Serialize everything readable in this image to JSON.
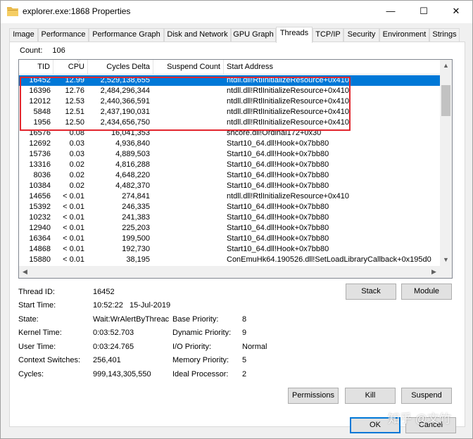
{
  "window": {
    "title": "explorer.exe:1868 Properties",
    "minimize_glyph": "—",
    "maximize_glyph": "☐",
    "close_glyph": "✕"
  },
  "tabs": [
    {
      "label": "Image"
    },
    {
      "label": "Performance"
    },
    {
      "label": "Performance Graph"
    },
    {
      "label": "Disk and Network"
    },
    {
      "label": "GPU Graph"
    },
    {
      "label": "Threads",
      "active": true
    },
    {
      "label": "TCP/IP"
    },
    {
      "label": "Security"
    },
    {
      "label": "Environment"
    },
    {
      "label": "Strings"
    }
  ],
  "count": {
    "label": "Count:",
    "value": "106"
  },
  "table": {
    "columns": [
      "TID",
      "CPU",
      "Cycles Delta",
      "Suspend Count",
      "Start Address"
    ],
    "rows": [
      {
        "tid": "16452",
        "cpu": "12.99",
        "cycles": "2,529,138,655",
        "suspend": "",
        "addr": "ntdll.dll!RtlInitializeResource+0x410",
        "selected": true
      },
      {
        "tid": "16396",
        "cpu": "12.76",
        "cycles": "2,484,296,344",
        "suspend": "",
        "addr": "ntdll.dll!RtlInitializeResource+0x410"
      },
      {
        "tid": "12012",
        "cpu": "12.53",
        "cycles": "2,440,366,591",
        "suspend": "",
        "addr": "ntdll.dll!RtlInitializeResource+0x410"
      },
      {
        "tid": "5848",
        "cpu": "12.51",
        "cycles": "2,437,190,031",
        "suspend": "",
        "addr": "ntdll.dll!RtlInitializeResource+0x410"
      },
      {
        "tid": "1956",
        "cpu": "12.50",
        "cycles": "2,434,656,750",
        "suspend": "",
        "addr": "ntdll.dll!RtlInitializeResource+0x410"
      },
      {
        "tid": "16576",
        "cpu": "0.08",
        "cycles": "16,041,353",
        "suspend": "",
        "addr": "shcore.dll!Ordinal172+0x30"
      },
      {
        "tid": "12692",
        "cpu": "0.03",
        "cycles": "4,936,840",
        "suspend": "",
        "addr": "Start10_64.dll!Hook+0x7bb80"
      },
      {
        "tid": "15736",
        "cpu": "0.03",
        "cycles": "4,889,503",
        "suspend": "",
        "addr": "Start10_64.dll!Hook+0x7bb80"
      },
      {
        "tid": "13316",
        "cpu": "0.02",
        "cycles": "4,816,288",
        "suspend": "",
        "addr": "Start10_64.dll!Hook+0x7bb80"
      },
      {
        "tid": "8036",
        "cpu": "0.02",
        "cycles": "4,648,220",
        "suspend": "",
        "addr": "Start10_64.dll!Hook+0x7bb80"
      },
      {
        "tid": "10384",
        "cpu": "0.02",
        "cycles": "4,482,370",
        "suspend": "",
        "addr": "Start10_64.dll!Hook+0x7bb80"
      },
      {
        "tid": "14656",
        "cpu": "< 0.01",
        "cycles": "274,841",
        "suspend": "",
        "addr": "ntdll.dll!RtlInitializeResource+0x410"
      },
      {
        "tid": "15392",
        "cpu": "< 0.01",
        "cycles": "246,335",
        "suspend": "",
        "addr": "Start10_64.dll!Hook+0x7bb80"
      },
      {
        "tid": "10232",
        "cpu": "< 0.01",
        "cycles": "241,383",
        "suspend": "",
        "addr": "Start10_64.dll!Hook+0x7bb80"
      },
      {
        "tid": "12940",
        "cpu": "< 0.01",
        "cycles": "225,203",
        "suspend": "",
        "addr": "Start10_64.dll!Hook+0x7bb80"
      },
      {
        "tid": "16364",
        "cpu": "< 0.01",
        "cycles": "199,500",
        "suspend": "",
        "addr": "Start10_64.dll!Hook+0x7bb80"
      },
      {
        "tid": "14868",
        "cpu": "< 0.01",
        "cycles": "192,730",
        "suspend": "",
        "addr": "Start10_64.dll!Hook+0x7bb80"
      },
      {
        "tid": "15880",
        "cpu": "< 0.01",
        "cycles": "38,195",
        "suspend": "",
        "addr": "ConEmuHk64.190526.dll!SetLoadLibraryCallback+0x195d0"
      }
    ]
  },
  "details": {
    "thread_id": {
      "label": "Thread ID:",
      "value": "16452"
    },
    "start_time": {
      "label": "Start Time:",
      "value": "10:52:22   15-Jul-2019"
    },
    "state": {
      "label": "State:",
      "value": "Wait:WrAlertByThreac"
    },
    "kernel_time": {
      "label": "Kernel Time:",
      "value": "0:03:52.703"
    },
    "user_time": {
      "label": "User Time:",
      "value": "0:03:24.765"
    },
    "context_switches": {
      "label": "Context Switches:",
      "value": "256,401"
    },
    "cycles": {
      "label": "Cycles:",
      "value": "999,143,305,550"
    },
    "base_priority": {
      "label": "Base Priority:",
      "value": "8"
    },
    "dynamic_priority": {
      "label": "Dynamic Priority:",
      "value": "9"
    },
    "io_priority": {
      "label": "I/O Priority:",
      "value": "Normal"
    },
    "memory_priority": {
      "label": "Memory Priority:",
      "value": "5"
    },
    "ideal_processor": {
      "label": "Ideal Processor:",
      "value": "2"
    }
  },
  "buttons": {
    "stack": "Stack",
    "module": "Module",
    "permissions": "Permissions",
    "kill": "Kill",
    "suspend": "Suspend",
    "ok": "OK",
    "cancel": "Cancel"
  },
  "watermark": "知乎 @文竹",
  "colors": {
    "selection": "#0078d7",
    "highlight_box": "#e2252d"
  }
}
